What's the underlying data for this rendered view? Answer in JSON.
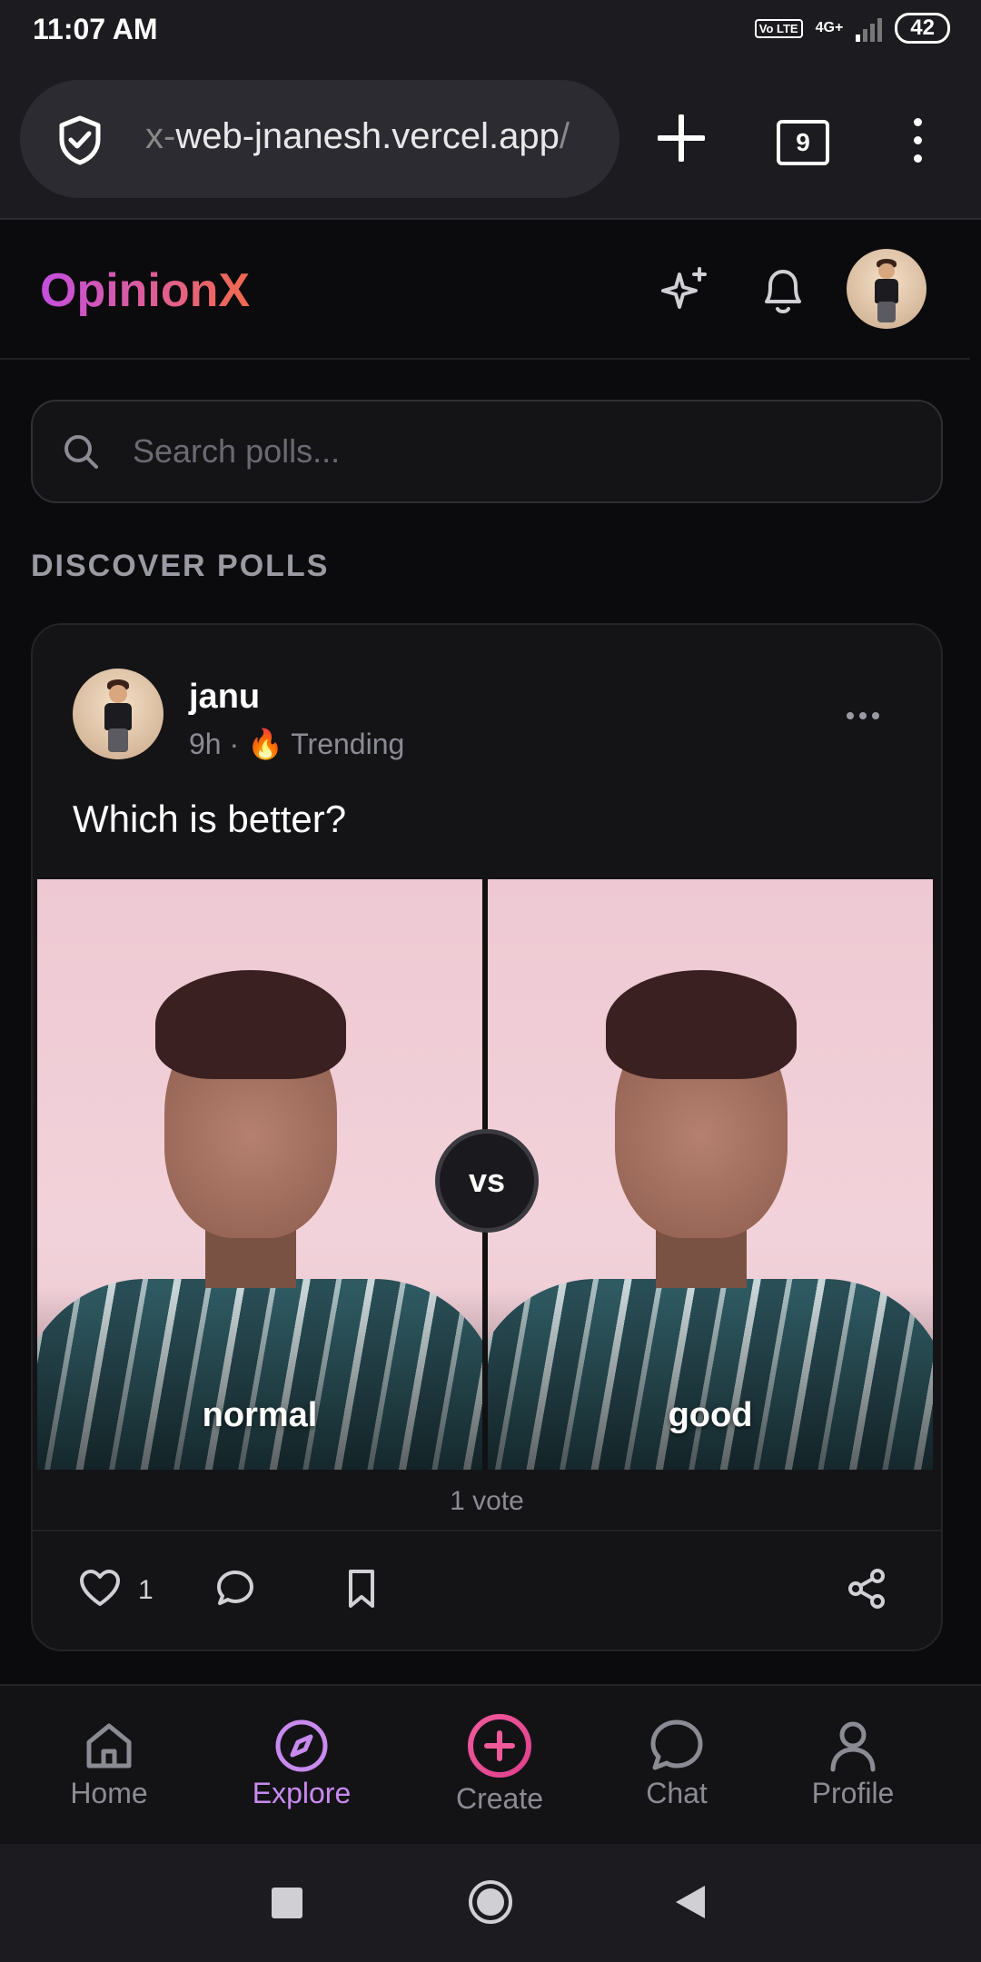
{
  "status_bar": {
    "time": "11:07 AM",
    "network": "4G+",
    "volte": "Vo LTE",
    "battery": "42"
  },
  "browser": {
    "url_prefix": "x-",
    "url_main": "web-jnanesh.vercel.app",
    "url_trailing": "/",
    "tab_count": "9"
  },
  "app": {
    "logo": "OpinionX"
  },
  "search": {
    "placeholder": "Search polls..."
  },
  "section_title": "DISCOVER POLLS",
  "poll": {
    "author": "janu",
    "time": "9h",
    "badge": "Trending",
    "question": "Which is better?",
    "option_a": "normal",
    "option_b": "good",
    "vs": "vs",
    "votes": "1 vote",
    "likes": "1"
  },
  "nav": {
    "items": [
      {
        "label": "Home",
        "icon": "home-icon"
      },
      {
        "label": "Explore",
        "icon": "compass-icon",
        "active": true
      },
      {
        "label": "Create",
        "icon": "plus-circle-icon"
      },
      {
        "label": "Chat",
        "icon": "chat-icon"
      },
      {
        "label": "Profile",
        "icon": "user-icon"
      }
    ]
  },
  "colors": {
    "accent": "#c44ee0",
    "accent2": "#f26a4c",
    "background": "#0b0b0d"
  }
}
